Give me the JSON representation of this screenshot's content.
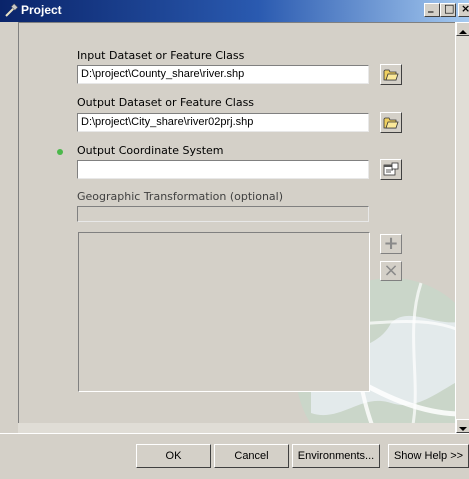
{
  "window": {
    "title": "Project",
    "controls": {
      "minimize": "_",
      "maximize": "□",
      "close": "×"
    }
  },
  "form": {
    "input": {
      "label": "Input Dataset or Feature Class",
      "value": "D:\\project\\County_share\\river.shp",
      "browse_icon": "open-folder-icon"
    },
    "output": {
      "label": "Output Dataset or Feature Class",
      "value": "D:\\project\\City_share\\river02prj.shp",
      "browse_icon": "open-folder-icon"
    },
    "coordinate_system": {
      "label": "Output Coordinate System",
      "value": "",
      "required_marker": "green-dot",
      "properties_icon": "properties-icon"
    },
    "geo_transformation": {
      "label": "Geographic Transformation (optional)",
      "value": "",
      "items": []
    },
    "side_buttons": {
      "add": "+",
      "remove": "×"
    }
  },
  "buttons": {
    "ok": "OK",
    "cancel": "Cancel",
    "environments": "Environments...",
    "show_help": "Show Help >>"
  },
  "colors": {
    "title_start": "#0a246a",
    "title_end": "#a6caf0",
    "dialog": "#d4d0c8",
    "required": "#4bb84b"
  }
}
